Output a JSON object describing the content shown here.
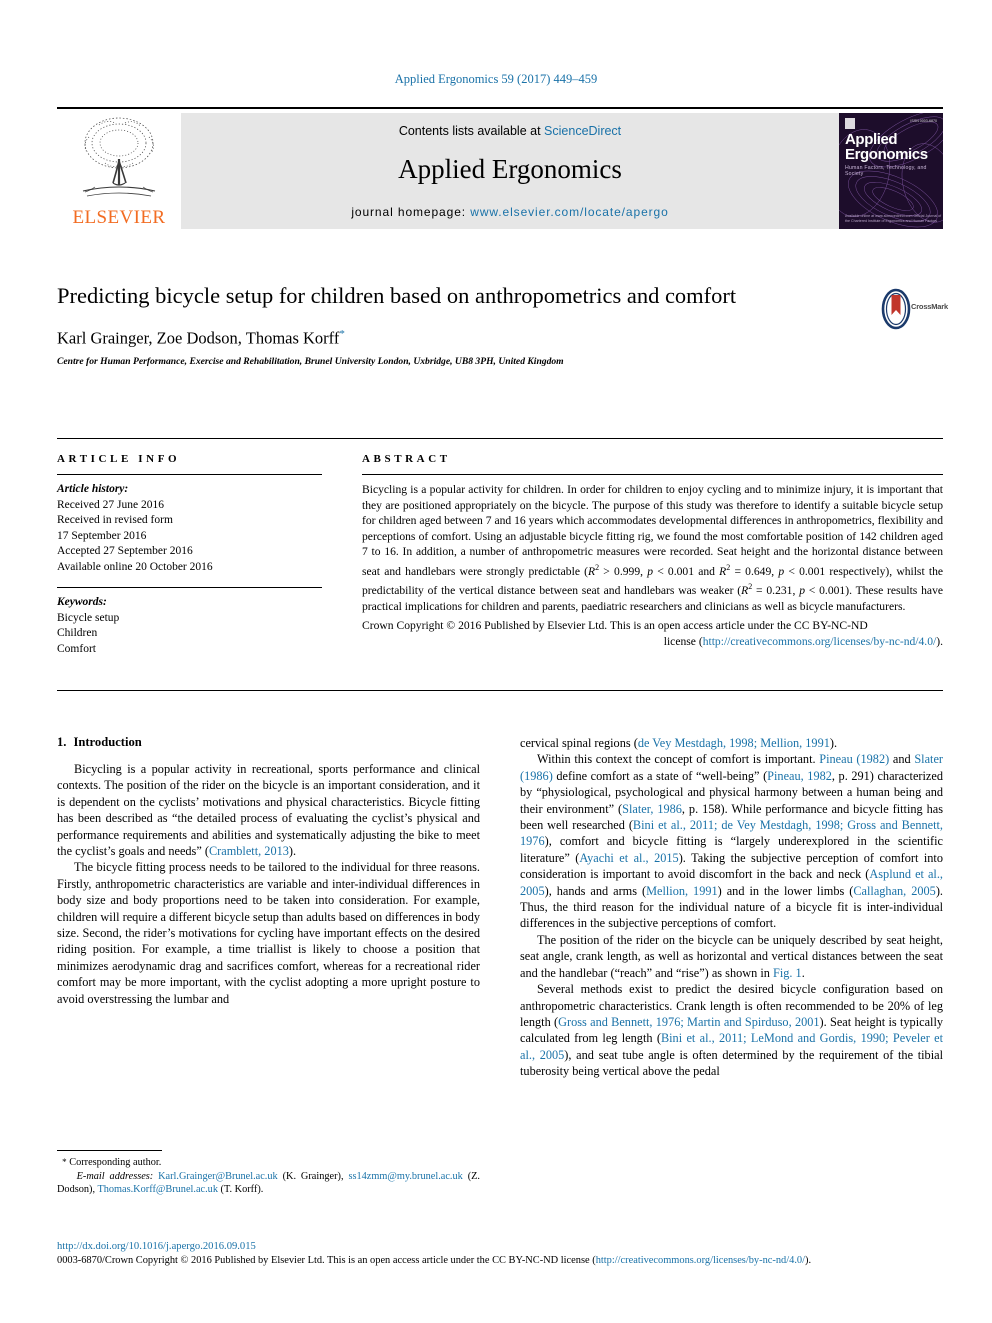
{
  "running_head": "Applied Ergonomics 59 (2017) 449–459",
  "masthead": {
    "publisher_name": "ELSEVIER",
    "contents_prefix": "Contents lists available at",
    "contents_link": "ScienceDirect",
    "journal_title": "Applied Ergonomics",
    "homepage_prefix": "journal homepage:",
    "homepage_link": "www.elsevier.com/locate/apergo",
    "cover": {
      "title_line1": "Applied",
      "title_line2": "Ergonomics",
      "subtitle": "Human Factors, Technology, and Society",
      "issue": "ISSN 0003-6870",
      "footer": "Available online at www.sciencedirect.com\nOfficial Journal of the Chartered Institute of Ergonomics and Human Factors"
    }
  },
  "article": {
    "title": "Predicting bicycle setup for children based on anthropometrics and comfort",
    "authors": "Karl Grainger, Zoe Dodson, Thomas Korff",
    "corresponding_marker": "*",
    "affiliation": "Centre for Human Performance, Exercise and Rehabilitation, Brunel University London, Uxbridge, UB8 3PH, United Kingdom",
    "crossmark_label": "CrossMark"
  },
  "article_info": {
    "heading": "ARTICLE INFO",
    "history_label": "Article history:",
    "history": [
      "Received 27 June 2016",
      "Received in revised form",
      "17 September 2016",
      "Accepted 27 September 2016",
      "Available online 20 October 2016"
    ],
    "keywords_label": "Keywords:",
    "keywords": [
      "Bicycle setup",
      "Children",
      "Comfort"
    ]
  },
  "abstract": {
    "heading": "ABSTRACT",
    "p1_a": "Bicycling is a popular activity for children. In order for children to enjoy cycling and to minimize injury, it is important that they are positioned appropriately on the bicycle. The purpose of this study was therefore to identify a suitable bicycle setup for children aged between 7 and 16 years which accommodates developmental differences in anthropometrics, flexibility and perceptions of comfort. Using an adjustable bicycle fitting rig, we found the most comfortable position of 142 children aged 7 to 16. In addition, a number of anthropometric measures were recorded. Seat height and the horizontal distance between seat and handlebars were strongly predictable (",
    "stat1_r": "R",
    "stat1_sup": "2",
    "stat1_rest": " > 0.999, ",
    "stat1_p": "p",
    "stat1_pval": " < 0.001 and ",
    "stat2_r": "R",
    "stat2_sup": "2",
    "stat2_rest": " = 0.649, ",
    "stat2_p": "p",
    "stat2_pval": " < 0.001",
    "p1_b": " respectively), whilst the predictability of the vertical distance between seat and handlebars was weaker (",
    "stat3_r": "R",
    "stat3_sup": "2",
    "stat3_rest": " = 0.231, ",
    "stat3_p": "p",
    "stat3_pval": " < 0.001",
    "p1_c": "). These results have practical implications for children and parents, paediatric researchers and clinicians as well as bicycle manufacturers.",
    "copyright_line": "Crown Copyright © 2016 Published by Elsevier Ltd. This is an open access article under the CC BY-NC-ND",
    "license_prefix": "license (",
    "license_link": "http://creativecommons.org/licenses/by-nc-nd/4.0/",
    "license_suffix": ")."
  },
  "sections": {
    "intro_number": "1.",
    "intro_title": "Introduction"
  },
  "body": {
    "left": {
      "p1_a": "Bicycling is a popular activity in recreational, sports performance and clinical contexts. The position of the rider on the bicycle is an important consideration, and it is dependent on the cyclists’ motivations and physical characteristics. Bicycle fitting has been described as “the detailed process of evaluating the cyclist’s physical and performance requirements and abilities and systematically adjusting the bike to meet the cyclist’s goals and needs” (",
      "p1_cite1": "Cramblett, 2013",
      "p1_b": ").",
      "p2": "The bicycle fitting process needs to be tailored to the individual for three reasons. Firstly, anthropometric characteristics are variable and inter-individual differences in body size and body proportions need to be taken into consideration. For example, children will require a different bicycle setup than adults based on differences in body size. Second, the rider’s motivations for cycling have important effects on the desired riding position. For example, a time triallist is likely to choose a position that minimizes aerodynamic drag and sacrifices comfort, whereas for a recreational rider comfort may be more important, with the cyclist adopting a more upright posture to avoid overstressing the lumbar and"
    },
    "right": {
      "p0_a": "cervical spinal regions (",
      "p0_cite": "de Vey Mestdagh, 1998; Mellion, 1991",
      "p0_b": ").",
      "p1_a": "Within this context the concept of comfort is important. ",
      "p1_cite1": "Pineau (1982)",
      "p1_b": " and ",
      "p1_cite2": "Slater (1986)",
      "p1_c": " define comfort as a state of “well-being” (",
      "p1_cite3": "Pineau, 1982",
      "p1_d": ", p. 291) characterized by “physiological, psychological and physical harmony between a human being and their environment” (",
      "p1_cite4": "Slater, 1986",
      "p1_e": ", p. 158). While performance and bicycle fitting has been well researched (",
      "p1_cite5": "Bini et al., 2011; de Vey Mestdagh, 1998; Gross and Bennett, 1976",
      "p1_f": "), comfort and bicycle fitting is “largely underexplored in the scientific literature” (",
      "p1_cite6": "Ayachi et al., 2015",
      "p1_g": "). Taking the subjective perception of comfort into consideration is important to avoid discomfort in the back and neck (",
      "p1_cite7": "Asplund et al., 2005",
      "p1_h": "), hands and arms (",
      "p1_cite8": "Mellion, 1991",
      "p1_i": ") and in the lower limbs (",
      "p1_cite9": "Callaghan, 2005",
      "p1_j": "). Thus, the third reason for the individual nature of a bicycle fit is inter-individual differences in the subjective perceptions of comfort.",
      "p2_a": "The position of the rider on the bicycle can be uniquely described by seat height, seat angle, crank length, as well as horizontal and vertical distances between the seat and the handlebar (“reach” and “rise”) as shown in ",
      "p2_figref": "Fig. 1",
      "p2_b": ".",
      "p3_a": "Several methods exist to predict the desired bicycle configuration based on anthropometric characteristics. Crank length is often recommended to be 20% of leg length (",
      "p3_cite1": "Gross and Bennett, 1976; Martin and Spirduso, 2001",
      "p3_b": "). Seat height is typically calculated from leg length (",
      "p3_cite2": "Bini et al., 2011; LeMond and Gordis, 1990; Peveler et al., 2005",
      "p3_c": "), and seat tube angle is often determined by the requirement of the tibial tuberosity being vertical above the pedal"
    }
  },
  "footnotes": {
    "corresponding_marker": "*",
    "corresponding_text": "Corresponding author.",
    "email_label": "E-mail addresses:",
    "email1": "Karl.Grainger@Brunel.ac.uk",
    "email1_name": "(K. Grainger)",
    "email2": "ss14zmm@my.brunel.ac.uk",
    "email2_name": "(Z. Dodson)",
    "email3": "Thomas.Korff@Brunel.ac.uk",
    "email3_name": "(T. Korff)",
    "comma": ", "
  },
  "bottom": {
    "doi": "http://dx.doi.org/10.1016/j.apergo.2016.09.015",
    "issn_copy": "0003-6870/Crown Copyright © 2016 Published by Elsevier Ltd. This is an open access article under the CC BY-NC-ND license (",
    "license_link": "http://creativecommons.org/licenses/by-nc-nd/4.0/",
    "license_suffix": ")."
  },
  "colors": {
    "link": "#1a72a8",
    "elsevier_orange": "#f26c22",
    "banner_grey": "#e6e6e6",
    "cover_purple": "#3b1d52"
  }
}
